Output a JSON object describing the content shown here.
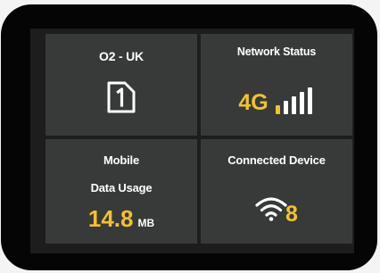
{
  "operator": {
    "name": "O2 - UK",
    "icon": "sim-card-icon"
  },
  "network": {
    "title": "Network Status",
    "type": "4G",
    "signal_bars": 4,
    "signal_bars_max": 5,
    "accent": "#f2c22e"
  },
  "data_usage": {
    "title_line1": "Mobile",
    "title_line2": "Data Usage",
    "value": "14.8",
    "unit": "MB"
  },
  "devices": {
    "title": "Connected Device",
    "count": "8",
    "icon": "wifi-icon"
  },
  "colors": {
    "tile": "#373a38",
    "screen": "#1c1d1c",
    "accent": "#f2c22e",
    "text": "#ffffff"
  }
}
